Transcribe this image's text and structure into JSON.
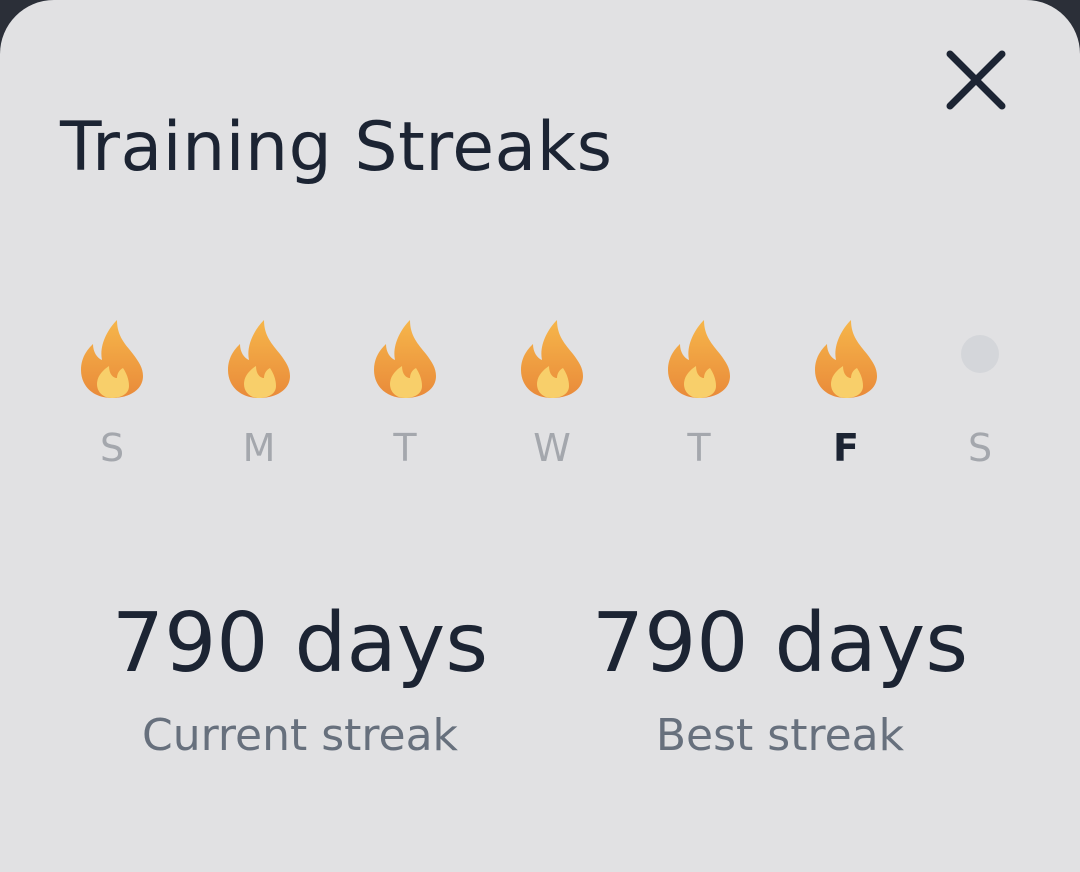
{
  "sheet": {
    "title": "Training Streaks",
    "close_icon": "close-icon"
  },
  "week": {
    "days": [
      {
        "letter": "S",
        "state": "flame"
      },
      {
        "letter": "M",
        "state": "flame"
      },
      {
        "letter": "T",
        "state": "flame"
      },
      {
        "letter": "W",
        "state": "flame"
      },
      {
        "letter": "T",
        "state": "flame"
      },
      {
        "letter": "F",
        "state": "flame",
        "today": true
      },
      {
        "letter": "S",
        "state": "empty"
      }
    ]
  },
  "stats": {
    "current": {
      "value": "790 days",
      "label": "Current streak"
    },
    "best": {
      "value": "790 days",
      "label": "Best streak"
    }
  },
  "colors": {
    "background": "#e1e1e3",
    "text_dark": "#1c2433",
    "text_muted": "#67707d",
    "day_inactive": "#a4a7ad",
    "flame_outer": "#f0a23a",
    "flame_inner": "#f7c85a",
    "empty_dot": "#d4d6da"
  }
}
